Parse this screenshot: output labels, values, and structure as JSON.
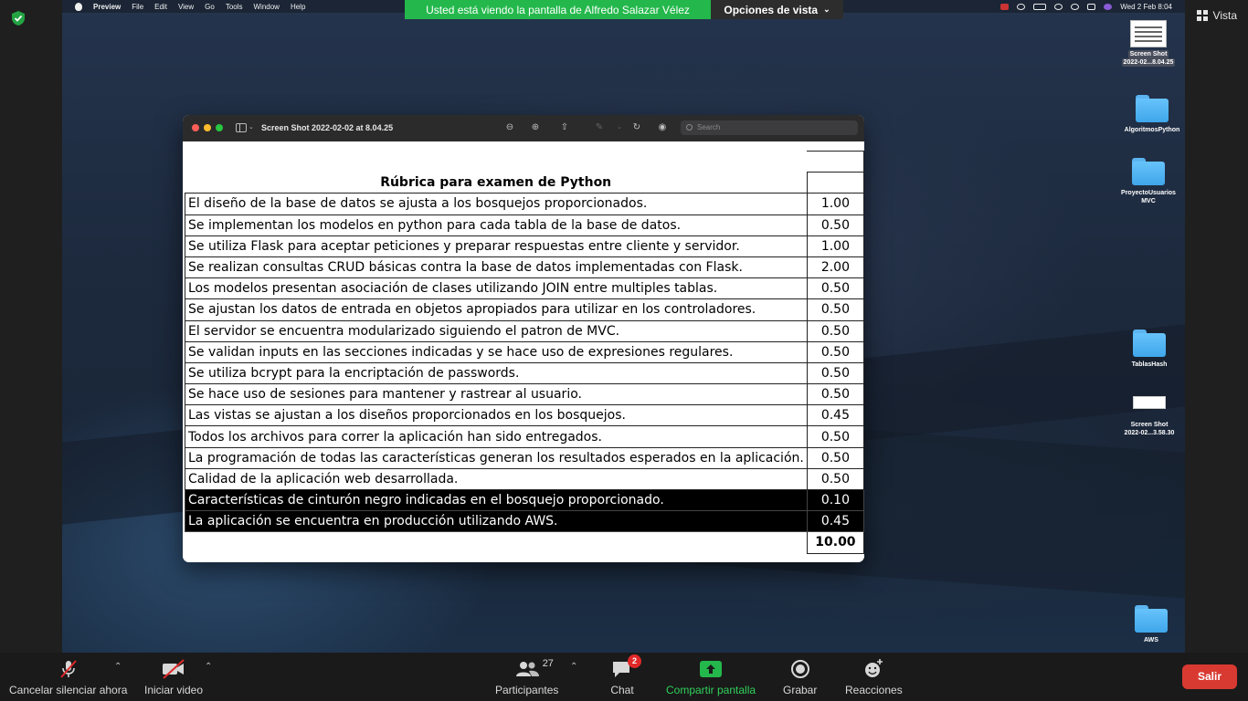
{
  "menubar": {
    "app": "Preview",
    "items": [
      "File",
      "Edit",
      "View",
      "Go",
      "Tools",
      "Window",
      "Help"
    ],
    "clock": "Wed 2 Feb  8:04"
  },
  "share_banner": {
    "viewing": "Usted está viendo la pantalla de Alfredo Salazar Vélez",
    "options": "Opciones de vista"
  },
  "zoom_top": {
    "view_label": "Vista"
  },
  "desktop_icons": [
    {
      "name": "Screen Shot",
      "sub": "2022-02...8.04.25"
    },
    {
      "name": "AlgoritmosPython",
      "sub": ""
    },
    {
      "name": "ProyectoUsuarios",
      "sub": "MVC"
    },
    {
      "name": "TablasHash",
      "sub": ""
    },
    {
      "name": "Screen Shot",
      "sub": "2022-02...3.58.30"
    },
    {
      "name": "AWS",
      "sub": ""
    }
  ],
  "preview_window": {
    "title": "Screen Shot 2022-02-02 at 8.04.25",
    "search_placeholder": "Search"
  },
  "rubric": {
    "title": "Rúbrica para examen de Python",
    "rows": [
      {
        "desc": "El diseño de la base de datos se ajusta a los bosquejos proporcionados.",
        "value": "1.00"
      },
      {
        "desc": "Se implementan los modelos en python para cada tabla de la base de datos.",
        "value": "0.50"
      },
      {
        "desc": "Se utiliza Flask para aceptar peticiones y preparar respuestas entre cliente y servidor.",
        "value": "1.00"
      },
      {
        "desc": "Se realizan consultas CRUD básicas contra la base de datos implementadas con Flask.",
        "value": "2.00"
      },
      {
        "desc": "Los modelos presentan asociación de clases utilizando JOIN entre multiples tablas.",
        "value": "0.50"
      },
      {
        "desc": "Se ajustan los datos de entrada en objetos apropiados para utilizar en los controladores.",
        "value": "0.50"
      },
      {
        "desc": "El servidor se encuentra modularizado siguiendo el patron de MVC.",
        "value": "0.50"
      },
      {
        "desc": "Se validan inputs en las secciones indicadas y se hace uso de expresiones regulares.",
        "value": "0.50"
      },
      {
        "desc": "Se utiliza bcrypt para la encriptación de passwords.",
        "value": "0.50"
      },
      {
        "desc": "Se hace uso de sesiones para mantener y rastrear al usuario.",
        "value": "0.50"
      },
      {
        "desc": "Las vistas se ajustan a los diseños proporcionados en los bosquejos.",
        "value": "0.45"
      },
      {
        "desc": "Todos los archivos para correr la aplicación han sido entregados.",
        "value": "0.50"
      },
      {
        "desc": "La programación de todas las características generan los resultados esperados en la aplicación.",
        "value": "0.50"
      },
      {
        "desc": "Calidad de la aplicación web desarrollada.",
        "value": "0.50"
      },
      {
        "desc": "Características de cinturón negro indicadas en el bosquejo proporcionado.",
        "value": "0.10"
      },
      {
        "desc": "La aplicación se encuentra en producción utilizando AWS.",
        "value": "0.45"
      }
    ],
    "total": "10.00"
  },
  "toolbar": {
    "mute": "Cancelar silenciar ahora",
    "video": "Iniciar video",
    "participants": "Participantes",
    "participants_count": "27",
    "chat": "Chat",
    "chat_badge": "2",
    "share": "Compartir pantalla",
    "record": "Grabar",
    "reactions": "Reacciones",
    "leave": "Salir"
  },
  "colors": {
    "zoom_green": "#24b84c",
    "leave_red": "#d83a32",
    "badge_red": "#e02828"
  }
}
